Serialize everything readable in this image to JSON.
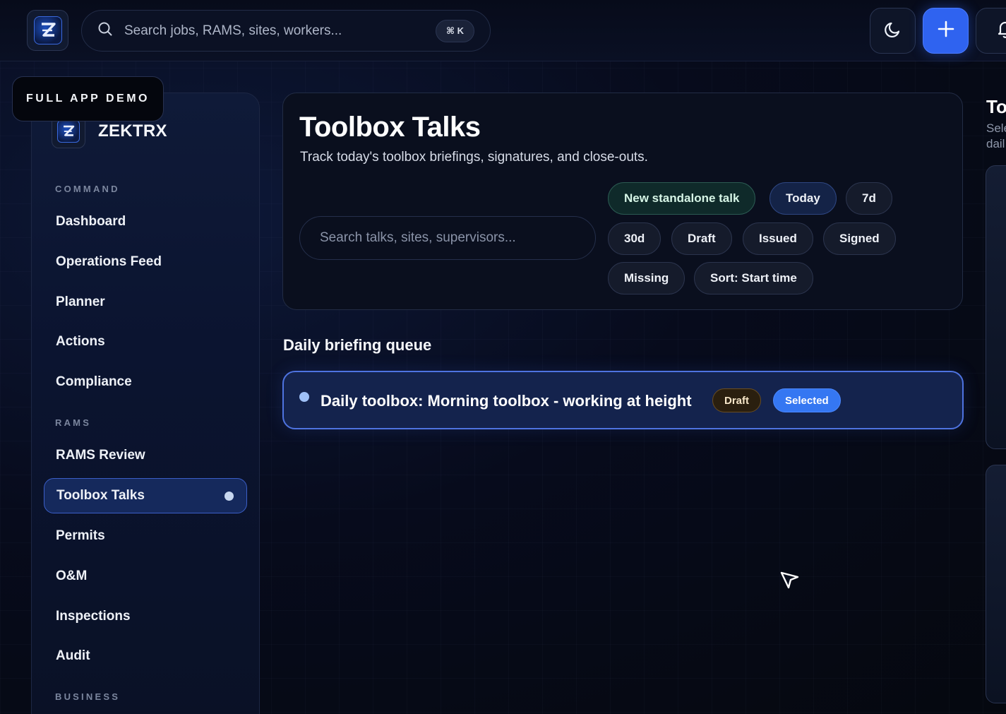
{
  "topbar": {
    "search_placeholder": "Search jobs, RAMS, sites, workers...",
    "shortcut": "⌘ K",
    "icons": [
      "search-icon",
      "moon-icon",
      "plus-icon",
      "bell-icon"
    ]
  },
  "demo_badge": "FULL APP DEMO",
  "sidebar": {
    "brand": "ZEKTRX",
    "sections": {
      "command": "COMMAND",
      "rams": "RAMS",
      "business": "BUSINESS"
    },
    "items": [
      {
        "label": "Dashboard"
      },
      {
        "label": "Operations Feed"
      },
      {
        "label": "Planner"
      },
      {
        "label": "Actions"
      },
      {
        "label": "Compliance"
      },
      {
        "label": "RAMS Review"
      },
      {
        "label": "Toolbox Talks",
        "active": true
      },
      {
        "label": "Permits"
      },
      {
        "label": "O&M"
      },
      {
        "label": "Inspections"
      },
      {
        "label": "Audit"
      }
    ]
  },
  "header": {
    "title": "Toolbox Talks",
    "subtitle": "Track today's toolbox briefings, signatures, and close-outs.",
    "search_placeholder": "Search talks, sites, supervisors...",
    "chips": [
      {
        "label": "New standalone talk"
      },
      {
        "label": "Today"
      },
      {
        "label": "7d"
      },
      {
        "label": "30d"
      },
      {
        "label": "Draft"
      },
      {
        "label": "Issued"
      },
      {
        "label": "Signed"
      },
      {
        "label": "Missing"
      },
      {
        "label": "Sort: Start time"
      }
    ]
  },
  "queue": {
    "title": "Daily briefing queue",
    "rows": [
      {
        "title": "Daily toolbox: Morning toolbox - working at height",
        "status": "Draft",
        "state": "Selected"
      }
    ]
  },
  "right_panel": {
    "title": "To",
    "subtitle_line1": "Sele",
    "subtitle_line2": "dail"
  },
  "colors": {
    "accent": "#2f63f0",
    "background": "#060a18",
    "selected_badge": "#3577f2"
  }
}
